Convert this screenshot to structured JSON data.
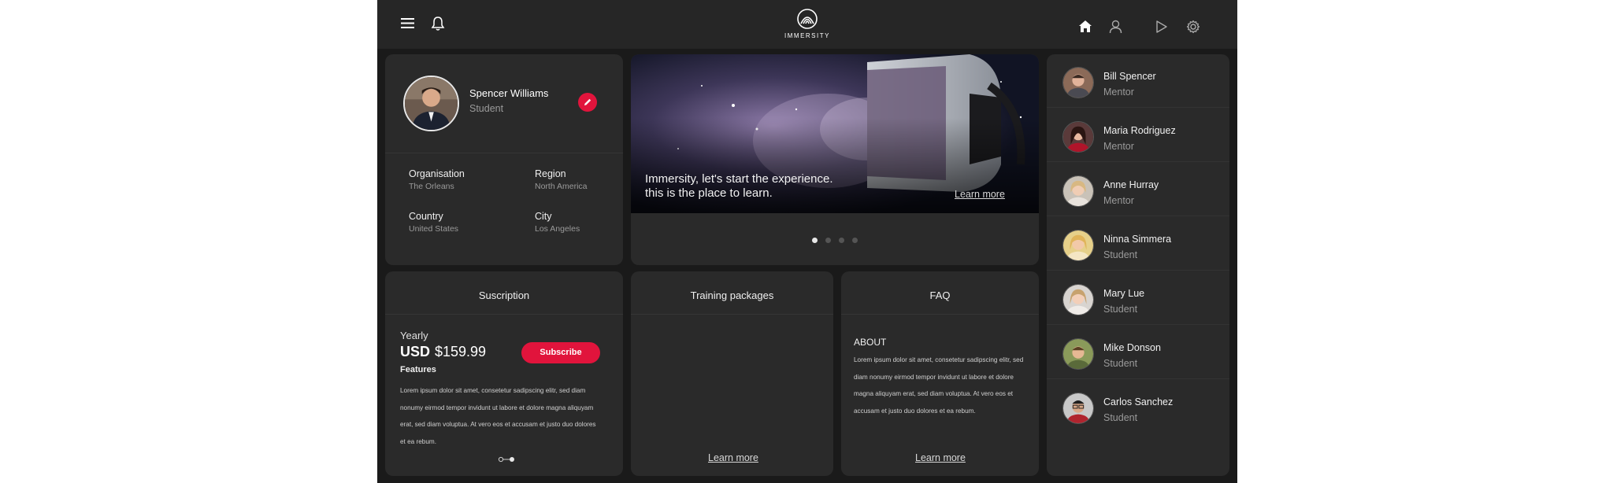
{
  "app": {
    "brand": "IMMERSITY",
    "accent": "#e1143c"
  },
  "nav": {
    "icons": [
      "menu-icon",
      "bell-icon",
      "home-icon",
      "user-icon",
      "play-icon",
      "gear-icon"
    ]
  },
  "profile": {
    "name": "Spencer Williams",
    "role": "Student",
    "fields": [
      {
        "label": "Organisation",
        "value": "The Orleans"
      },
      {
        "label": "Region",
        "value": "North America"
      },
      {
        "label": "Country",
        "value": "United States"
      },
      {
        "label": "City",
        "value": "Los Angeles"
      }
    ]
  },
  "hero": {
    "line1": "Immersity, let's start the experience.",
    "line2": "this is the place to learn.",
    "link": "Learn more",
    "slides": 4,
    "active_slide": 0
  },
  "subscription": {
    "title": "Suscription",
    "period": "Yearly",
    "currency": "USD",
    "price": "$159.99",
    "button": "Subscribe",
    "features_label": "Features",
    "features_text": "Lorem ipsum dolor sit amet, consetetur sadipscing elitr, sed diam nonumy eirmod tempor invidunt ut labore et dolore magna aliquyam erat, sed diam voluptua. At vero eos et accusam et justo duo dolores et ea rebum."
  },
  "training": {
    "title": "Training packages",
    "link": "Learn more"
  },
  "faq": {
    "title": "FAQ",
    "section": "ABOUT",
    "text": "Lorem ipsum dolor sit amet, consetetur sadipscing elitr, sed diam nonumy eirmod tempor invidunt ut labore et dolore magna aliquyam erat, sed diam voluptua. At vero eos et accusam et justo duo dolores et ea rebum.",
    "link": "Learn more"
  },
  "people": [
    {
      "name": "Bill Spencer",
      "role": "Mentor"
    },
    {
      "name": "Maria Rodriguez",
      "role": "Mentor"
    },
    {
      "name": "Anne Hurray",
      "role": "Mentor"
    },
    {
      "name": "Ninna Simmera",
      "role": "Student"
    },
    {
      "name": "Mary Lue",
      "role": "Student"
    },
    {
      "name": "Mike Donson",
      "role": "Student"
    },
    {
      "name": "Carlos Sanchez",
      "role": "Student"
    }
  ]
}
